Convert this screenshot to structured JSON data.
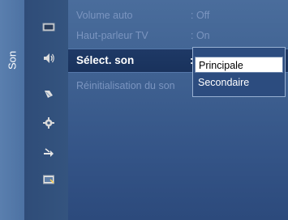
{
  "side_tab": {
    "label": "Son"
  },
  "icons": [
    {
      "name": "picture-icon"
    },
    {
      "name": "sound-icon"
    },
    {
      "name": "channel-icon"
    },
    {
      "name": "setup-icon"
    },
    {
      "name": "input-icon"
    },
    {
      "name": "application-icon"
    }
  ],
  "menu": {
    "items": [
      {
        "label": "Volume auto",
        "value": ": Off"
      },
      {
        "label": "Haut-parleur TV",
        "value": ": On"
      },
      {
        "label": "Sélect. son",
        "value": ":"
      },
      {
        "label": "Réinitialisation du son",
        "value": ""
      }
    ]
  },
  "dropdown": {
    "options": [
      "Principale",
      "Secondaire"
    ],
    "selected": "Principale"
  },
  "colors": {
    "background": "#3f6191",
    "selected_row": "#1e3966",
    "dim_text": "#7b95c0",
    "highlight_option": "#ffffff"
  }
}
